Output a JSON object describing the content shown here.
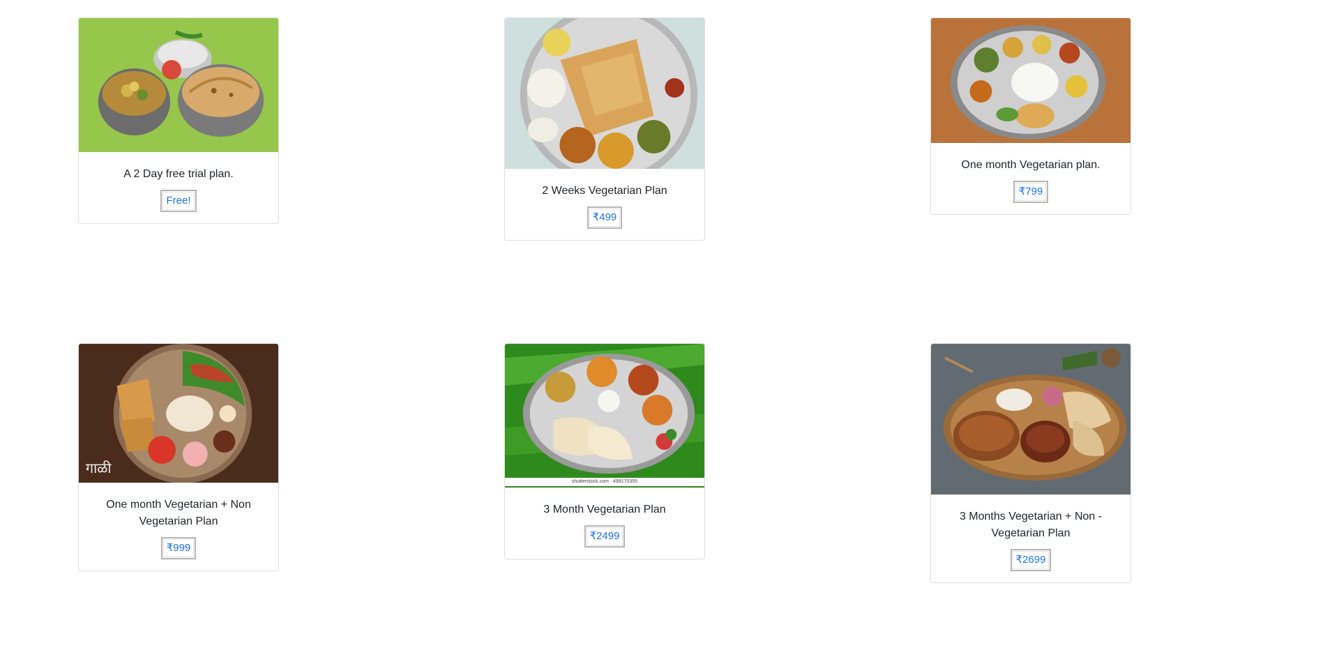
{
  "plans": [
    {
      "title": "A 2 Day free trial plan.",
      "price": "Free!",
      "image": "food-tiffin-image"
    },
    {
      "title": "2 Weeks Vegetarian Plan",
      "price": "₹499",
      "image": "paratha-thali-image"
    },
    {
      "title": "One month Vegetarian plan.",
      "price": "₹799",
      "image": "veg-thali-image"
    },
    {
      "title": "One month Vegetarian + Non Vegetarian Plan",
      "price": "₹999",
      "image": "fish-thali-image"
    },
    {
      "title": "3 Month Vegetarian Plan",
      "price": "₹2499",
      "image": "banana-leaf-thali-image",
      "watermark": "shutterstock.com · 499170355"
    },
    {
      "title": "3 Months Vegetarian + Non - Vegetarian Plan",
      "price": "₹2699",
      "image": "nonveg-thali-image"
    }
  ],
  "colors": {
    "price_text": "#1a73e8",
    "card_border": "#dcdcdc"
  }
}
